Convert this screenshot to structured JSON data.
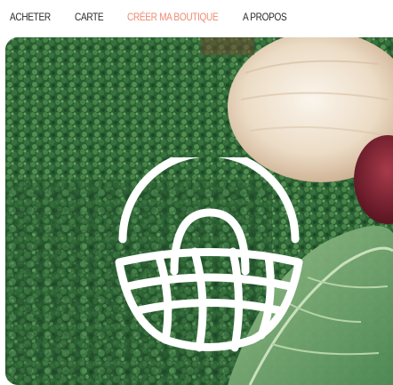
{
  "nav": {
    "items": [
      {
        "label": "ACHETER",
        "active": false
      },
      {
        "label": "CARTE",
        "active": false
      },
      {
        "label": "CRÉER MA BOUTIQUE",
        "active": true
      },
      {
        "label": "A PROPOS",
        "active": false
      }
    ]
  },
  "hero": {
    "image": "kale-onion-vegetables-photo",
    "logo_icon": "basket-icon"
  },
  "colors": {
    "accent": "#f08a73",
    "nav_text": "#2a2a2a",
    "kale_dark": "#1f4d2c",
    "kale_mid": "#3f7a45",
    "kale_light": "#6fa36b",
    "onion": "#efe4d6",
    "logo": "#ffffff"
  }
}
